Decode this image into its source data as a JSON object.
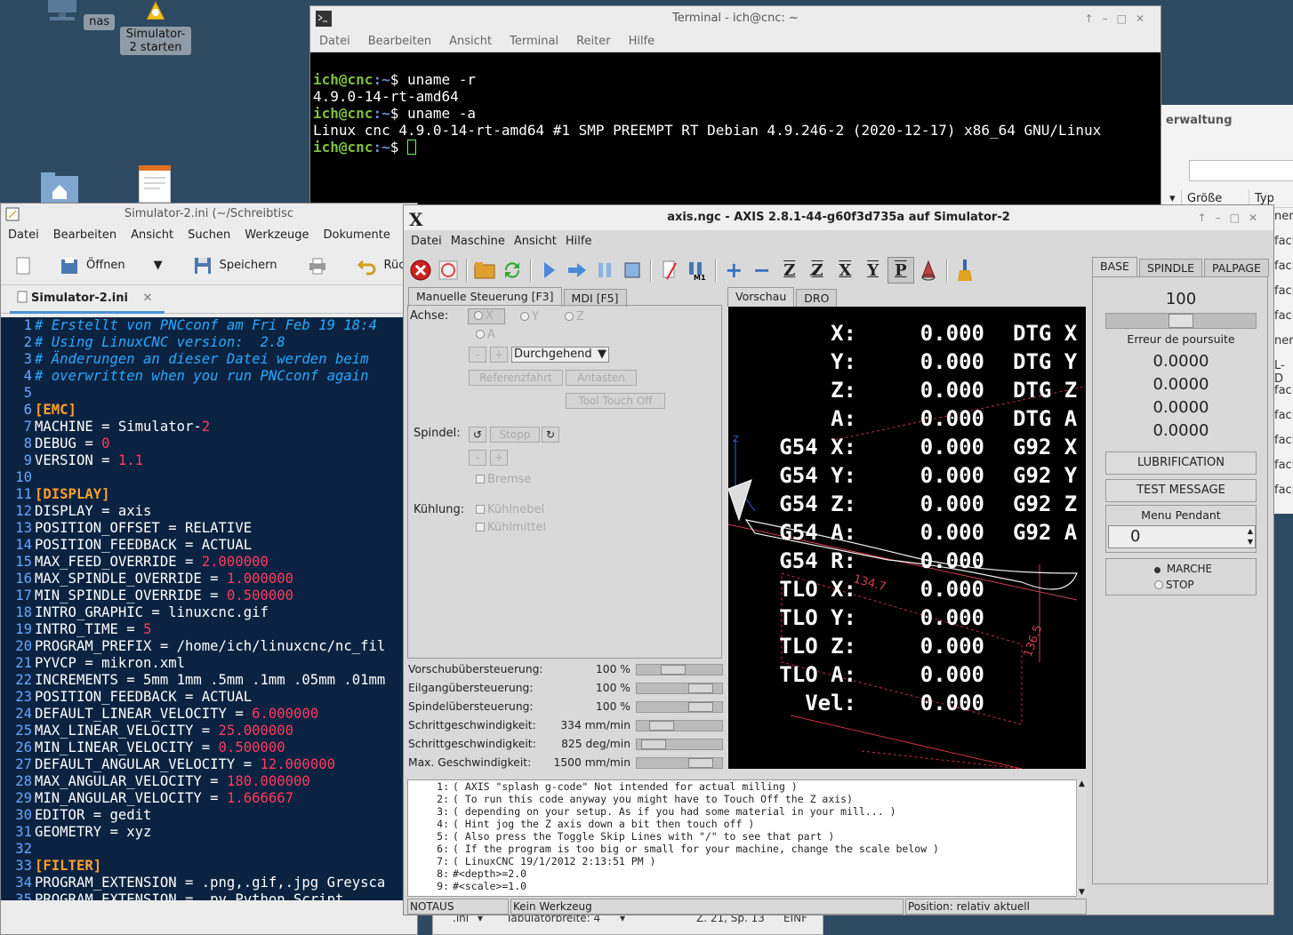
{
  "desktop": {
    "icons": [
      {
        "label": "nas"
      },
      {
        "label": "Simulator-2 starten"
      }
    ]
  },
  "file_manager": {
    "title_fragment": "erwaltung",
    "col_size": "Größe",
    "col_type": "Typ",
    "rows": [
      "ner",
      "fach",
      "fach",
      "fach",
      "fach",
      "neru",
      "L-D",
      "fach",
      "fach",
      "fach",
      "fach",
      "fach"
    ]
  },
  "terminal": {
    "title": "Terminal - ich@cnc: ~",
    "menu": [
      "Datei",
      "Bearbeiten",
      "Ansicht",
      "Terminal",
      "Reiter",
      "Hilfe"
    ],
    "lines": [
      {
        "prompt_user": "ich@cnc",
        "prompt_path": ":~",
        "cmd": "$ uname -r"
      },
      {
        "output": "4.9.0-14-rt-amd64"
      },
      {
        "prompt_user": "ich@cnc",
        "prompt_path": ":~",
        "cmd": "$ uname -a"
      },
      {
        "output": "Linux cnc 4.9.0-14-rt-amd64 #1 SMP PREEMPT RT Debian 4.9.246-2 (2020-12-17) x86_64 GNU/Linux"
      },
      {
        "prompt_user": "ich@cnc",
        "prompt_path": ":~",
        "cmd": "$ "
      }
    ]
  },
  "gedit": {
    "title": "Simulator-2.ini (~/Schreibtisc",
    "menu": [
      "Datei",
      "Bearbeiten",
      "Ansicht",
      "Suchen",
      "Werkzeuge",
      "Dokumente"
    ],
    "toolbar": {
      "open_label": "Öffnen",
      "save_label": "Speichern",
      "undo_label": "Rüc"
    },
    "tab_label": "Simulator-2.ini",
    "lines": [
      [
        {
          "t": "# Erstellt von PNCconf am Fri Feb 19 18:4",
          "c": "com"
        }
      ],
      [
        {
          "t": "# Using LinuxCNC version:  2.8",
          "c": "com"
        }
      ],
      [
        {
          "t": "# Änderungen an dieser Datei werden beim ",
          "c": "com"
        }
      ],
      [
        {
          "t": "# overwritten when you run PNCconf again",
          "c": "com"
        }
      ],
      [],
      [
        {
          "t": "[EMC]",
          "c": "sec"
        }
      ],
      [
        {
          "t": "MACHINE = Simulator-",
          "c": "txt"
        },
        {
          "t": "2",
          "c": "num"
        }
      ],
      [
        {
          "t": "DEBUG = ",
          "c": "txt"
        },
        {
          "t": "0",
          "c": "num"
        }
      ],
      [
        {
          "t": "VERSION = ",
          "c": "txt"
        },
        {
          "t": "1.1",
          "c": "num"
        }
      ],
      [],
      [
        {
          "t": "[DISPLAY]",
          "c": "sec"
        }
      ],
      [
        {
          "t": "DISPLAY = axis",
          "c": "txt"
        }
      ],
      [
        {
          "t": "POSITION_OFFSET = RELATIVE",
          "c": "txt"
        }
      ],
      [
        {
          "t": "POSITION_FEEDBACK = ACTUAL",
          "c": "txt"
        }
      ],
      [
        {
          "t": "MAX_FEED_OVERRIDE = ",
          "c": "txt"
        },
        {
          "t": "2.000000",
          "c": "num"
        }
      ],
      [
        {
          "t": "MAX_SPINDLE_OVERRIDE = ",
          "c": "txt"
        },
        {
          "t": "1.000000",
          "c": "num"
        }
      ],
      [
        {
          "t": "MIN_SPINDLE_OVERRIDE = ",
          "c": "txt"
        },
        {
          "t": "0.500000",
          "c": "num"
        }
      ],
      [
        {
          "t": "INTRO_GRAPHIC = linuxcnc.gif",
          "c": "txt"
        }
      ],
      [
        {
          "t": "INTRO_TIME = ",
          "c": "txt"
        },
        {
          "t": "5",
          "c": "num"
        }
      ],
      [
        {
          "t": "PROGRAM_PREFIX = /home/ich/linuxcnc/nc_fil",
          "c": "txt"
        }
      ],
      [
        {
          "t": "PYVCP = mikron.xml",
          "c": "txt"
        }
      ],
      [
        {
          "t": "INCREMENTS = 5mm 1mm .5mm .1mm .05mm .01mm",
          "c": "txt"
        }
      ],
      [
        {
          "t": "POSITION_FEEDBACK = ACTUAL",
          "c": "txt"
        }
      ],
      [
        {
          "t": "DEFAULT_LINEAR_VELOCITY = ",
          "c": "txt"
        },
        {
          "t": "6.000000",
          "c": "num"
        }
      ],
      [
        {
          "t": "MAX_LINEAR_VELOCITY = ",
          "c": "txt"
        },
        {
          "t": "25.000000",
          "c": "num"
        }
      ],
      [
        {
          "t": "MIN_LINEAR_VELOCITY = ",
          "c": "txt"
        },
        {
          "t": "0.500000",
          "c": "num"
        }
      ],
      [
        {
          "t": "DEFAULT_ANGULAR_VELOCITY = ",
          "c": "txt"
        },
        {
          "t": "12.000000",
          "c": "num"
        }
      ],
      [
        {
          "t": "MAX_ANGULAR_VELOCITY = ",
          "c": "txt"
        },
        {
          "t": "180.000000",
          "c": "num"
        }
      ],
      [
        {
          "t": "MIN_ANGULAR_VELOCITY = ",
          "c": "txt"
        },
        {
          "t": "1.666667",
          "c": "num"
        }
      ],
      [
        {
          "t": "EDITOR = gedit",
          "c": "txt"
        }
      ],
      [
        {
          "t": "GEOMETRY = xyz",
          "c": "txt"
        }
      ],
      [],
      [
        {
          "t": "[FILTER]",
          "c": "sec"
        }
      ],
      [
        {
          "t": "PROGRAM_EXTENSION = .png,.gif,.jpg Greysca",
          "c": "txt"
        }
      ],
      [
        {
          "t": "PROGRAM_EXTENSION = .py Python Script",
          "c": "txt"
        }
      ]
    ],
    "status": {
      "lang": ".ini",
      "tab_width": "Tabulatorbreite: 4",
      "position": "Z. 21, Sp. 13",
      "mode": "EINF"
    }
  },
  "axis": {
    "title": "axis.ngc - AXIS 2.8.1-44-g60f3d735a auf  Simulator-2",
    "menu": [
      "Datei",
      "Maschine",
      "Ansicht",
      "Hilfe"
    ],
    "tabs_left": [
      "Manuelle Steuerung [F3]",
      "MDI [F5]"
    ],
    "tabs_view": [
      "Vorschau",
      "DRO"
    ],
    "manual": {
      "achse_label": "Achse:",
      "axes": [
        "X",
        "Y",
        "Z",
        "A"
      ],
      "jog_mode": "Durchgehend",
      "minus": "-",
      "plus": "+",
      "home_button": "Referenzfahrt",
      "touch_button": "Antasten",
      "tool_touch_button": "Tool Touch Off",
      "spindle_label": "Spindel:",
      "spindle_stop": "Stopp",
      "brake_label": "Bremse",
      "coolant_label": "Kühlung:",
      "mist_label": "Kühlnebel",
      "flood_label": "Kühlmittel"
    },
    "sliders": [
      {
        "label": "Vorschubübersteuerung:",
        "value": "100 %",
        "fraction": 0.4
      },
      {
        "label": "Eilgangübersteuerung:",
        "value": "100 %",
        "fraction": 0.86
      },
      {
        "label": "Spindelübersteuerung:",
        "value": "100 %",
        "fraction": 0.86
      },
      {
        "label": "Schrittgeschwindigkeit:",
        "value": "334 mm/min",
        "fraction": 0.2
      },
      {
        "label": "Schrittgeschwindigkeit:",
        "value": "825 deg/min",
        "fraction": 0.08
      },
      {
        "label": "Max. Geschwindigkeit:",
        "value": "1500 mm/min",
        "fraction": 0.86
      }
    ],
    "dro": [
      {
        "label": "  X:",
        "value": "0.000",
        "right": "DTG X"
      },
      {
        "label": "  Y:",
        "value": "0.000",
        "right": "DTG Y"
      },
      {
        "label": "  Z:",
        "value": "0.000",
        "right": "DTG Z"
      },
      {
        "label": "  A:",
        "value": "0.000",
        "right": "DTG A"
      },
      {
        "label": "G54 X:",
        "value": "0.000",
        "right": "G92 X"
      },
      {
        "label": "G54 Y:",
        "value": "0.000",
        "right": "G92 Y"
      },
      {
        "label": "G54 Z:",
        "value": "0.000",
        "right": "G92 Z"
      },
      {
        "label": "G54 A:",
        "value": "0.000",
        "right": "G92 A"
      },
      {
        "label": "G54 R:",
        "value": "0.000",
        "right": ""
      },
      {
        "label": "TLO X:",
        "value": "0.000",
        "right": ""
      },
      {
        "label": "TLO Y:",
        "value": "0.000",
        "right": ""
      },
      {
        "label": "TLO Z:",
        "value": "0.000",
        "right": ""
      },
      {
        "label": "TLO A:",
        "value": "0.000",
        "right": ""
      },
      {
        "label": " Vel:",
        "value": "0.000",
        "right": ""
      }
    ],
    "preview": {
      "dim1": "134.7",
      "dim2": "136.5",
      "axis_z": "Z"
    },
    "gcode": [
      {
        "n": "1:",
        "t": "( AXIS \"splash g-code\" Not intended for actual milling )"
      },
      {
        "n": "2:",
        "t": "( To run this code anyway you might have to Touch Off the Z axis)"
      },
      {
        "n": "3:",
        "t": "( depending on your setup. As if you had some material in your mill... )"
      },
      {
        "n": "4:",
        "t": "( Hint jog the Z axis down a bit then touch off )"
      },
      {
        "n": "5:",
        "t": "( Also press the Toggle Skip Lines with \"/\" to see that part )"
      },
      {
        "n": "6:",
        "t": "( If the program is too big or small for your machine, change the scale below )"
      },
      {
        "n": "7:",
        "t": "( LinuxCNC 19/1/2012 2:13:51 PM )"
      },
      {
        "n": "8:",
        "t": "#<depth>=2.0"
      },
      {
        "n": "9:",
        "t": "#<scale>=1.0"
      }
    ],
    "status": {
      "estop": "NOTAUS",
      "tool": "Kein Werkzeug",
      "position": "Position: relativ aktuell"
    },
    "right_panel": {
      "tabs": [
        "BASE",
        "SPINDLE",
        "PALPAGE"
      ],
      "scale_value": "100",
      "scale_fraction": 0.5,
      "error_label": "Erreur de poursuite",
      "errors": [
        "0.0000",
        "0.0000",
        "0.0000",
        "0.0000"
      ],
      "lubrication": "LUBRIFICATION",
      "test_message": "TEST MESSAGE",
      "menu_pendant": "Menu Pendant",
      "pendant_value": "0",
      "marche": "MARCHE",
      "stop": "STOP"
    }
  },
  "colors": {
    "terminal_bg": "#000000",
    "editor_bg": "#0b2340",
    "prompt": "#7fbf3f",
    "estop_red": "#cc2222"
  }
}
